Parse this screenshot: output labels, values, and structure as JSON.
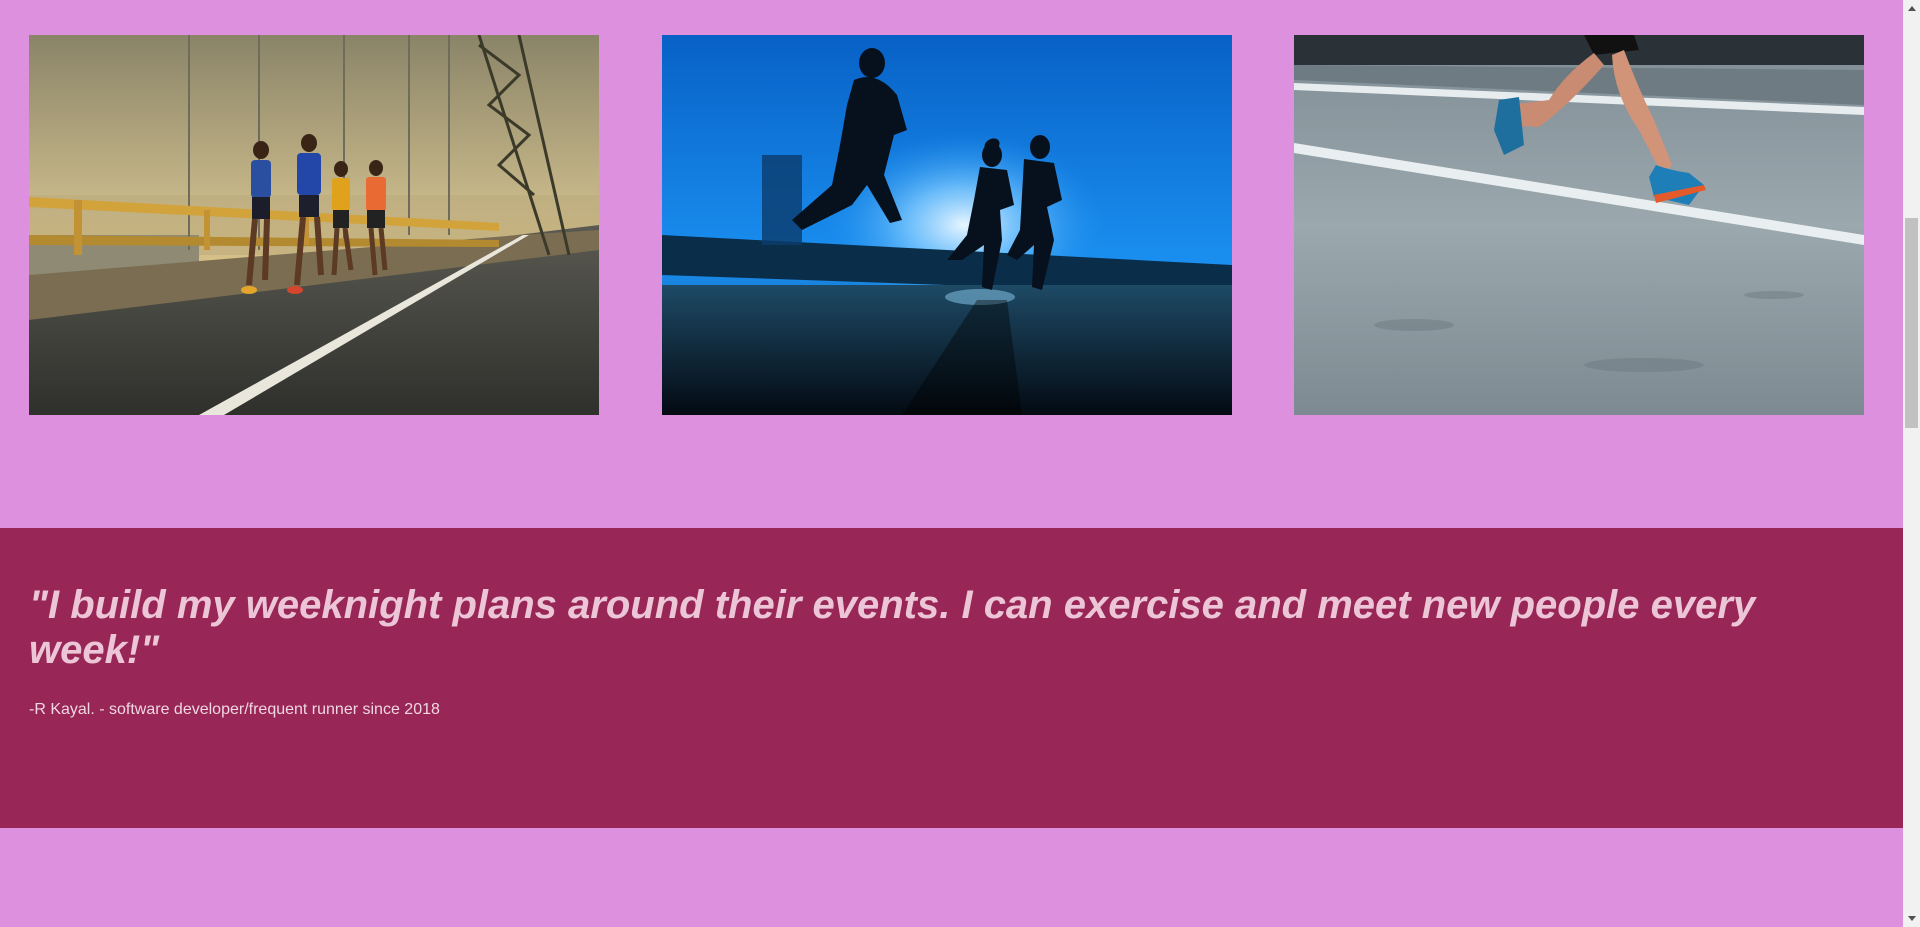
{
  "gallery": {
    "photos": [
      {
        "icon": "runners-on-bridge-photo"
      },
      {
        "icon": "silhouette-runners-photo"
      },
      {
        "icon": "runner-legs-photo"
      }
    ]
  },
  "testimonial": {
    "quote": "\"I build my weeknight plans around their events. I can exercise and meet new people every week!\"",
    "attribution": "-R Kayal. - software developer/frequent runner since 2018"
  },
  "colors": {
    "page_background": "#dd90dd",
    "testimonial_background": "#982656",
    "quote_text": "#ecc6d6"
  }
}
